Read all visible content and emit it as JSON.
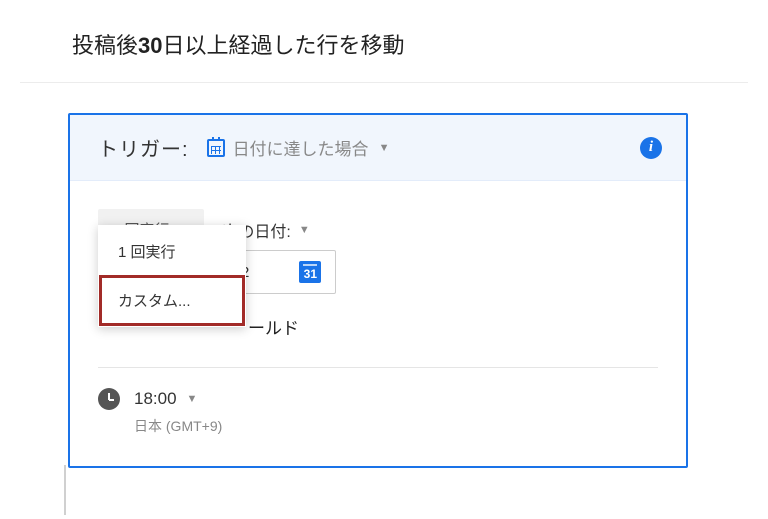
{
  "title_pre": "投稿後",
  "title_bold": "30",
  "title_post": "日以上経過した行を移動",
  "trigger": {
    "label": "トリガー:",
    "type": "日付に達した場合"
  },
  "freq_chip": "1 回実行",
  "on_date_label": "次の日付:",
  "date_value_partial": "2",
  "date_picker_glyph": "31",
  "dropdown": {
    "opt1": "1 回実行",
    "opt2": "カスタム..."
  },
  "field_tail": "ールド",
  "time": {
    "value": "18:00",
    "tz": "日本 (GMT+9)"
  }
}
